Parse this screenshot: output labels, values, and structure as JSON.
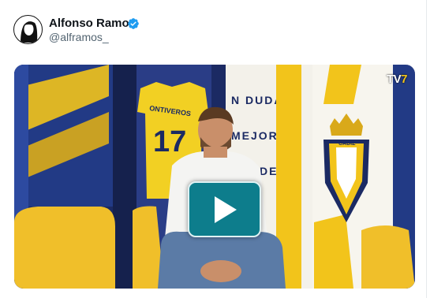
{
  "tweet": {
    "author_name": "Alfonso Ramos",
    "handle": "@alframos_",
    "verified": true
  },
  "media": {
    "type": "video",
    "channel_logo": {
      "prefix": "TV",
      "suffix": "7"
    },
    "jersey": {
      "name": "ONTIVEROS",
      "number": "17"
    },
    "wall_text_center": [
      "N DUDA",
      "MEJOR",
      "IPO DE"
    ],
    "crest_text": "CADIZ"
  },
  "colors": {
    "verified": "#1d9bf0",
    "club_yellow": "#f2c41b",
    "club_blue": "#1b2a63",
    "play_button": "#0d7d8c"
  }
}
